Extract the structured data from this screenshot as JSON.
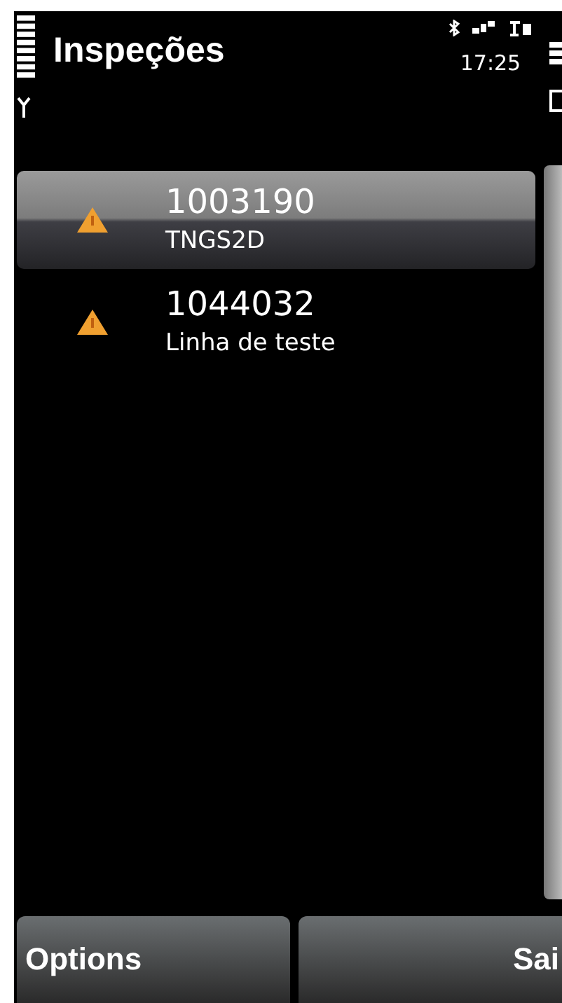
{
  "title": "Inspeções",
  "status_bar": {
    "time": "17:25"
  },
  "rows": [
    {
      "number": "1003190",
      "label": "TNGS2D",
      "selected": true
    },
    {
      "number": "1044032",
      "label": "Linha de teste",
      "selected": false
    }
  ],
  "softkeys": [
    "Options",
    "Sai"
  ]
}
